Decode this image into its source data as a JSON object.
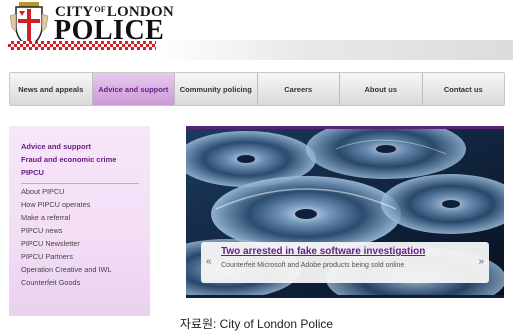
{
  "logo": {
    "line1_a": "CITY",
    "line1_of": "OF",
    "line1_b": "LONDON",
    "line2": "POLICE",
    "crest_icon": "city-of-london-crest-icon"
  },
  "colors": {
    "brand_purple": "#6a1e86",
    "nav_active_bg": "#c99ad6",
    "checker_red": "#d21f26",
    "sidebar_bg": "#f3ddf6"
  },
  "nav": {
    "items": [
      {
        "label": "News and appeals",
        "active": false
      },
      {
        "label": "Advice and support",
        "active": true
      },
      {
        "label": "Community policing",
        "active": false
      },
      {
        "label": "Careers",
        "active": false
      },
      {
        "label": "About us",
        "active": false
      },
      {
        "label": "Contact us",
        "active": false
      }
    ]
  },
  "sidebar": {
    "headings": [
      "Advice and support",
      "Fraud and economic crime",
      "PIPCU"
    ],
    "links": [
      "About PIPCU",
      "How PIPCU operates",
      "Make a referral",
      "PIPCU news",
      "PIPCU Newsletter",
      "PIPCU Partners",
      "Operation Creative and IWL",
      "Counterfeit Goods"
    ]
  },
  "banner": {
    "title": "Two arrested in fake software investigation",
    "subtitle": "Counterfeit Microsoft and Adobe products being sold online",
    "prev": "«",
    "next": "»"
  },
  "source_caption": "자료원: City of London Police"
}
